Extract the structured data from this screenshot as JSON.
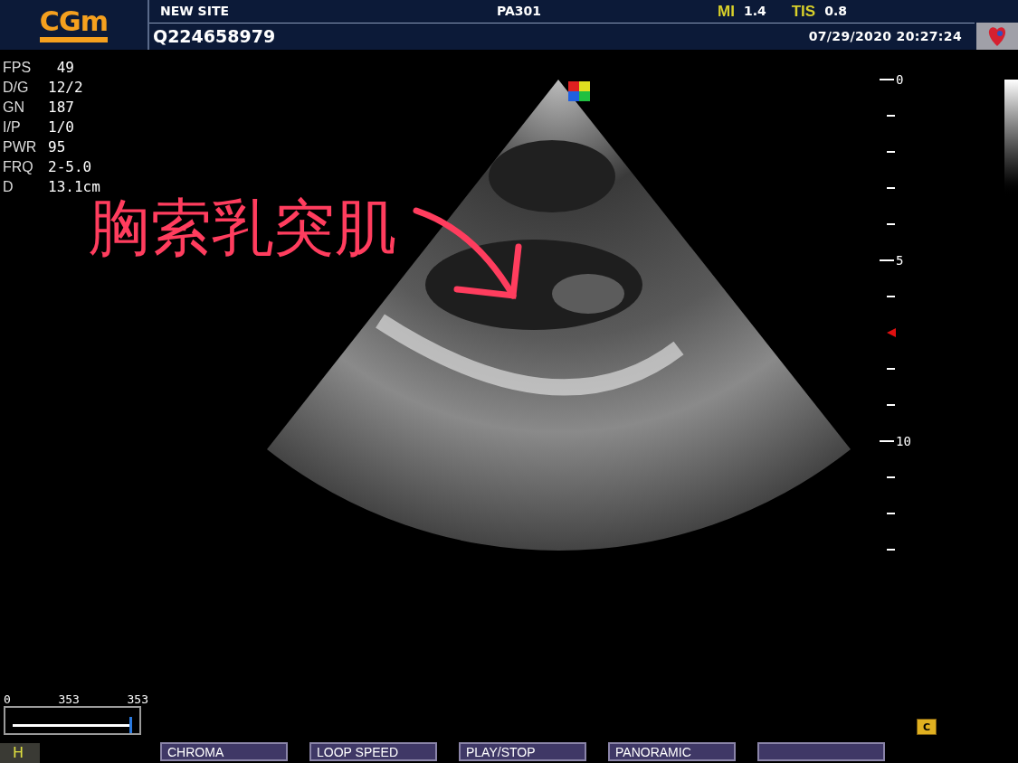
{
  "header": {
    "logo": "CGm",
    "site": "NEW SITE",
    "probe": "PA301",
    "indices": [
      {
        "label": "MI",
        "value": "1.4"
      },
      {
        "label": "TIS",
        "value": "0.8"
      }
    ],
    "patient_id": "Q224658979",
    "datetime": "07/29/2020 20:27:24"
  },
  "parameters": [
    {
      "label": "FPS",
      "value": " 49"
    },
    {
      "label": "D/G",
      "value": "12/2"
    },
    {
      "label": "GN",
      "value": "187"
    },
    {
      "label": "I/P",
      "value": "1/0"
    },
    {
      "label": "PWR",
      "value": "95"
    },
    {
      "label": "FRQ",
      "value": "2-5.0"
    },
    {
      "label": "D",
      "value": "13.1cm"
    }
  ],
  "annotation": "胸索乳突肌",
  "depth_scale": {
    "labels": [
      "0",
      "5",
      "10"
    ]
  },
  "cine": {
    "labels": [
      "0",
      "353",
      "353"
    ],
    "level": 1
  },
  "film_badge": "C",
  "mode": "H",
  "softkeys": [
    "CHROMA",
    "LOOP SPEED",
    "PLAY/STOP",
    "PANORAMIC"
  ]
}
